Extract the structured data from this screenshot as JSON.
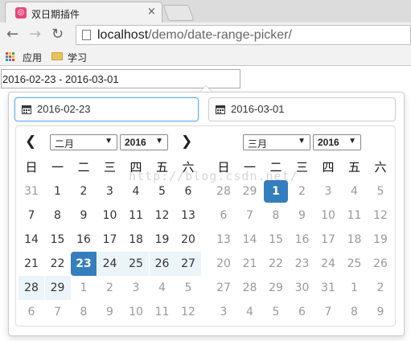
{
  "browser": {
    "tab_title": "双日期插件",
    "tab_close": "×",
    "url_host": "localhost",
    "url_path": "/demo/date-range-picker/",
    "bookmarks": [
      "应用",
      "学习"
    ]
  },
  "range_input": {
    "value": "2016-02-23 - 2016-03-01"
  },
  "start_field": {
    "value": "2016-02-23"
  },
  "end_field": {
    "value": "2016-03-01"
  },
  "weekdays": [
    "日",
    "一",
    "二",
    "三",
    "四",
    "五",
    "六"
  ],
  "left_calendar": {
    "month": "二月",
    "year": "2016",
    "prev_arrow": "❮",
    "next_arrow": "❯",
    "rows": [
      [
        "31",
        "1",
        "2",
        "3",
        "4",
        "5",
        "6"
      ],
      [
        "7",
        "8",
        "9",
        "10",
        "11",
        "12",
        "13"
      ],
      [
        "14",
        "15",
        "16",
        "17",
        "18",
        "19",
        "20"
      ],
      [
        "21",
        "22",
        "23",
        "24",
        "25",
        "26",
        "27"
      ],
      [
        "28",
        "29",
        "1",
        "2",
        "3",
        "4",
        "5"
      ],
      [
        "6",
        "7",
        "8",
        "9",
        "10",
        "11",
        "12"
      ]
    ],
    "off": [
      [
        0,
        0
      ],
      [
        4,
        2
      ],
      [
        4,
        3
      ],
      [
        4,
        4
      ],
      [
        4,
        5
      ],
      [
        4,
        6
      ],
      [
        5,
        0
      ],
      [
        5,
        1
      ],
      [
        5,
        2
      ],
      [
        5,
        3
      ],
      [
        5,
        4
      ],
      [
        5,
        5
      ],
      [
        5,
        6
      ]
    ],
    "in_range": [
      [
        3,
        3
      ],
      [
        3,
        4
      ],
      [
        3,
        5
      ],
      [
        3,
        6
      ],
      [
        4,
        0
      ],
      [
        4,
        1
      ]
    ],
    "active_start": [
      3,
      2
    ]
  },
  "right_calendar": {
    "month": "三月",
    "year": "2016",
    "rows": [
      [
        "28",
        "29",
        "1",
        "2",
        "3",
        "4",
        "5"
      ],
      [
        "6",
        "7",
        "8",
        "9",
        "10",
        "11",
        "12"
      ],
      [
        "13",
        "14",
        "15",
        "16",
        "17",
        "18",
        "19"
      ],
      [
        "20",
        "21",
        "22",
        "23",
        "24",
        "25",
        "26"
      ],
      [
        "27",
        "28",
        "29",
        "30",
        "31",
        "1",
        "2"
      ],
      [
        "3",
        "4",
        "5",
        "6",
        "7",
        "8",
        "9"
      ]
    ],
    "off_all_except": [
      [
        0,
        2
      ]
    ],
    "active": [
      0,
      2
    ]
  },
  "watermark": "http://blog.csdn.net/",
  "colors": {
    "accent": "#357ebd",
    "range": "#ebf4f8",
    "favicon": "#e8467c"
  },
  "icons": [
    "back-arrow-icon",
    "forward-arrow-icon",
    "reload-icon",
    "page-icon",
    "apps-grid-icon",
    "folder-icon",
    "calendar-icon",
    "chevron-left-icon",
    "chevron-right-icon",
    "dropdown-arrow-icon"
  ]
}
